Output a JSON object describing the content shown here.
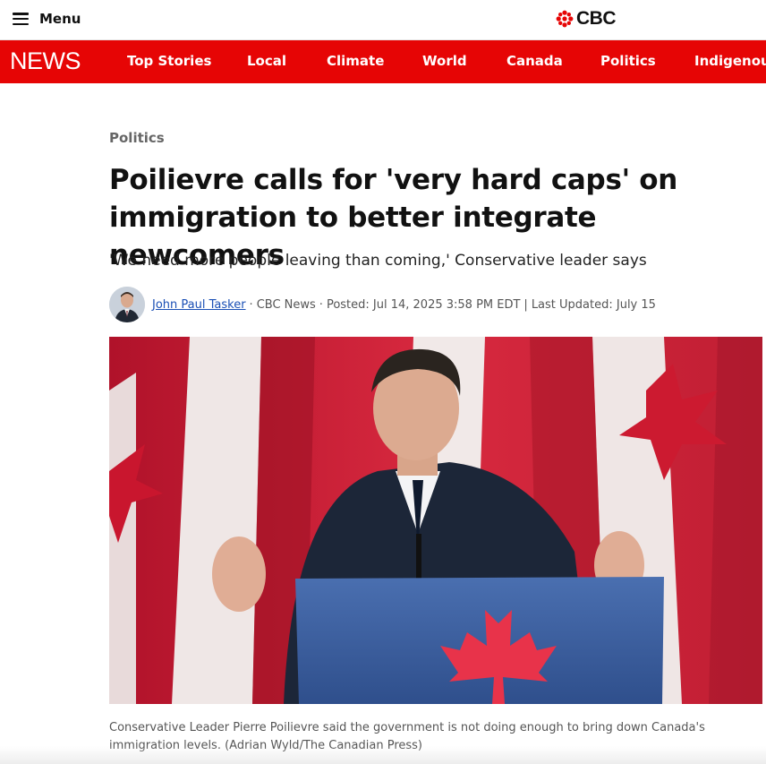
{
  "header": {
    "menu_label": "Menu",
    "brand": "CBC"
  },
  "nav": {
    "brand": "NEWS",
    "items": [
      "Top Stories",
      "Local",
      "Climate",
      "World",
      "Canada",
      "Politics",
      "Indigenous"
    ]
  },
  "article": {
    "section": "Politics",
    "headline": "Poilievre calls for 'very hard caps' on immigration to better integrate newcomers",
    "deck": "'We need more people leaving than coming,' Conservative leader says",
    "author": "John Paul Tasker",
    "outlet": "CBC News",
    "posted": "Posted: Jul 14, 2025 3:58 PM EDT",
    "updated": "Last Updated: July 15",
    "caption": "Conservative Leader Pierre Poilievre said the government is not doing enough to bring down Canada's immigration levels. (Adrian Wyld/The Canadian Press)"
  },
  "colors": {
    "brand_red": "#e60505",
    "link_blue": "#1a4fb5"
  }
}
